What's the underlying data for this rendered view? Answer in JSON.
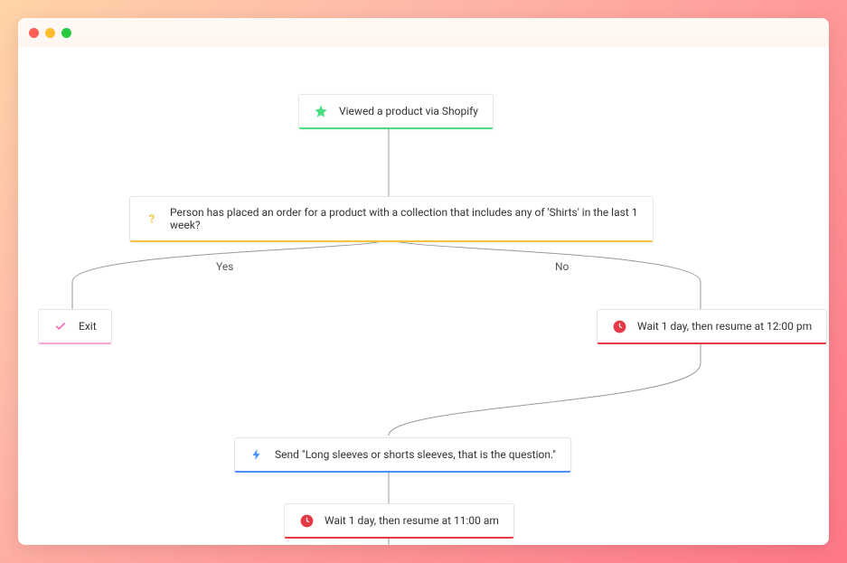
{
  "trigger": {
    "label": "Viewed a product via Shopify"
  },
  "condition": {
    "label": "Person has placed an order for a product with a collection that includes any of 'Shirts' in the last 1 week?"
  },
  "branches": {
    "yes": "Yes",
    "no": "No"
  },
  "exit": {
    "label": "Exit"
  },
  "wait1": {
    "label": "Wait 1 day, then resume at 12:00 pm"
  },
  "send": {
    "label": "Send \"Long sleeves or shorts sleeves, that is the question.\""
  },
  "wait2": {
    "label": "Wait 1 day, then resume at 11:00 am"
  }
}
